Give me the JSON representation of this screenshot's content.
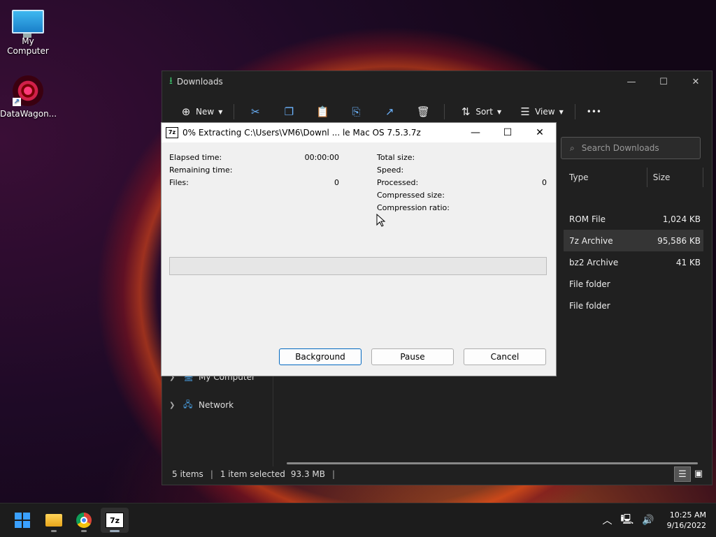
{
  "desktop": {
    "icons": [
      {
        "label": "My Computer",
        "icon": "monitor-icon"
      },
      {
        "label": "DataWagon...",
        "icon": "datawagon-icon"
      }
    ]
  },
  "explorer": {
    "title": "Downloads",
    "toolbar": {
      "new_label": "New",
      "sort_label": "Sort",
      "view_label": "View",
      "more_label": "•••"
    },
    "search_placeholder": "Search Downloads",
    "columns": {
      "type": "Type",
      "size": "Size"
    },
    "rows": [
      {
        "type": "ROM File",
        "size": "1,024 KB"
      },
      {
        "type": "7z Archive",
        "size": "95,586 KB"
      },
      {
        "type": "bz2 Archive",
        "size": "41 KB"
      },
      {
        "type": "File folder",
        "size": ""
      },
      {
        "type": "File folder",
        "size": ""
      }
    ],
    "nav": [
      {
        "label": "My Computer"
      },
      {
        "label": "Network"
      }
    ],
    "status": {
      "items": "5 items",
      "selected": "1 item selected",
      "selected_size": "93.3 MB"
    }
  },
  "dialog": {
    "title": "0% Extracting C:\\Users\\VM6\\Downl ... le Mac OS 7.5.3.7z",
    "app_icon_text": "7z",
    "left": {
      "elapsed_label": "Elapsed time:",
      "elapsed_value": "00:00:00",
      "remaining_label": "Remaining time:",
      "remaining_value": "",
      "files_label": "Files:",
      "files_value": "0"
    },
    "right": {
      "total_label": "Total size:",
      "speed_label": "Speed:",
      "processed_label": "Processed:",
      "processed_value": "0",
      "compressed_label": "Compressed size:",
      "ratio_label": "Compression ratio:"
    },
    "progress_percent": 0,
    "buttons": {
      "background": "Background",
      "pause": "Pause",
      "cancel": "Cancel"
    }
  },
  "taskbar": {
    "apps": [
      "start-icon",
      "file-explorer-icon",
      "chrome-icon",
      "7zip-icon"
    ],
    "z7_text": "7z",
    "clock": {
      "time": "10:25 AM",
      "date": "9/16/2022"
    }
  }
}
